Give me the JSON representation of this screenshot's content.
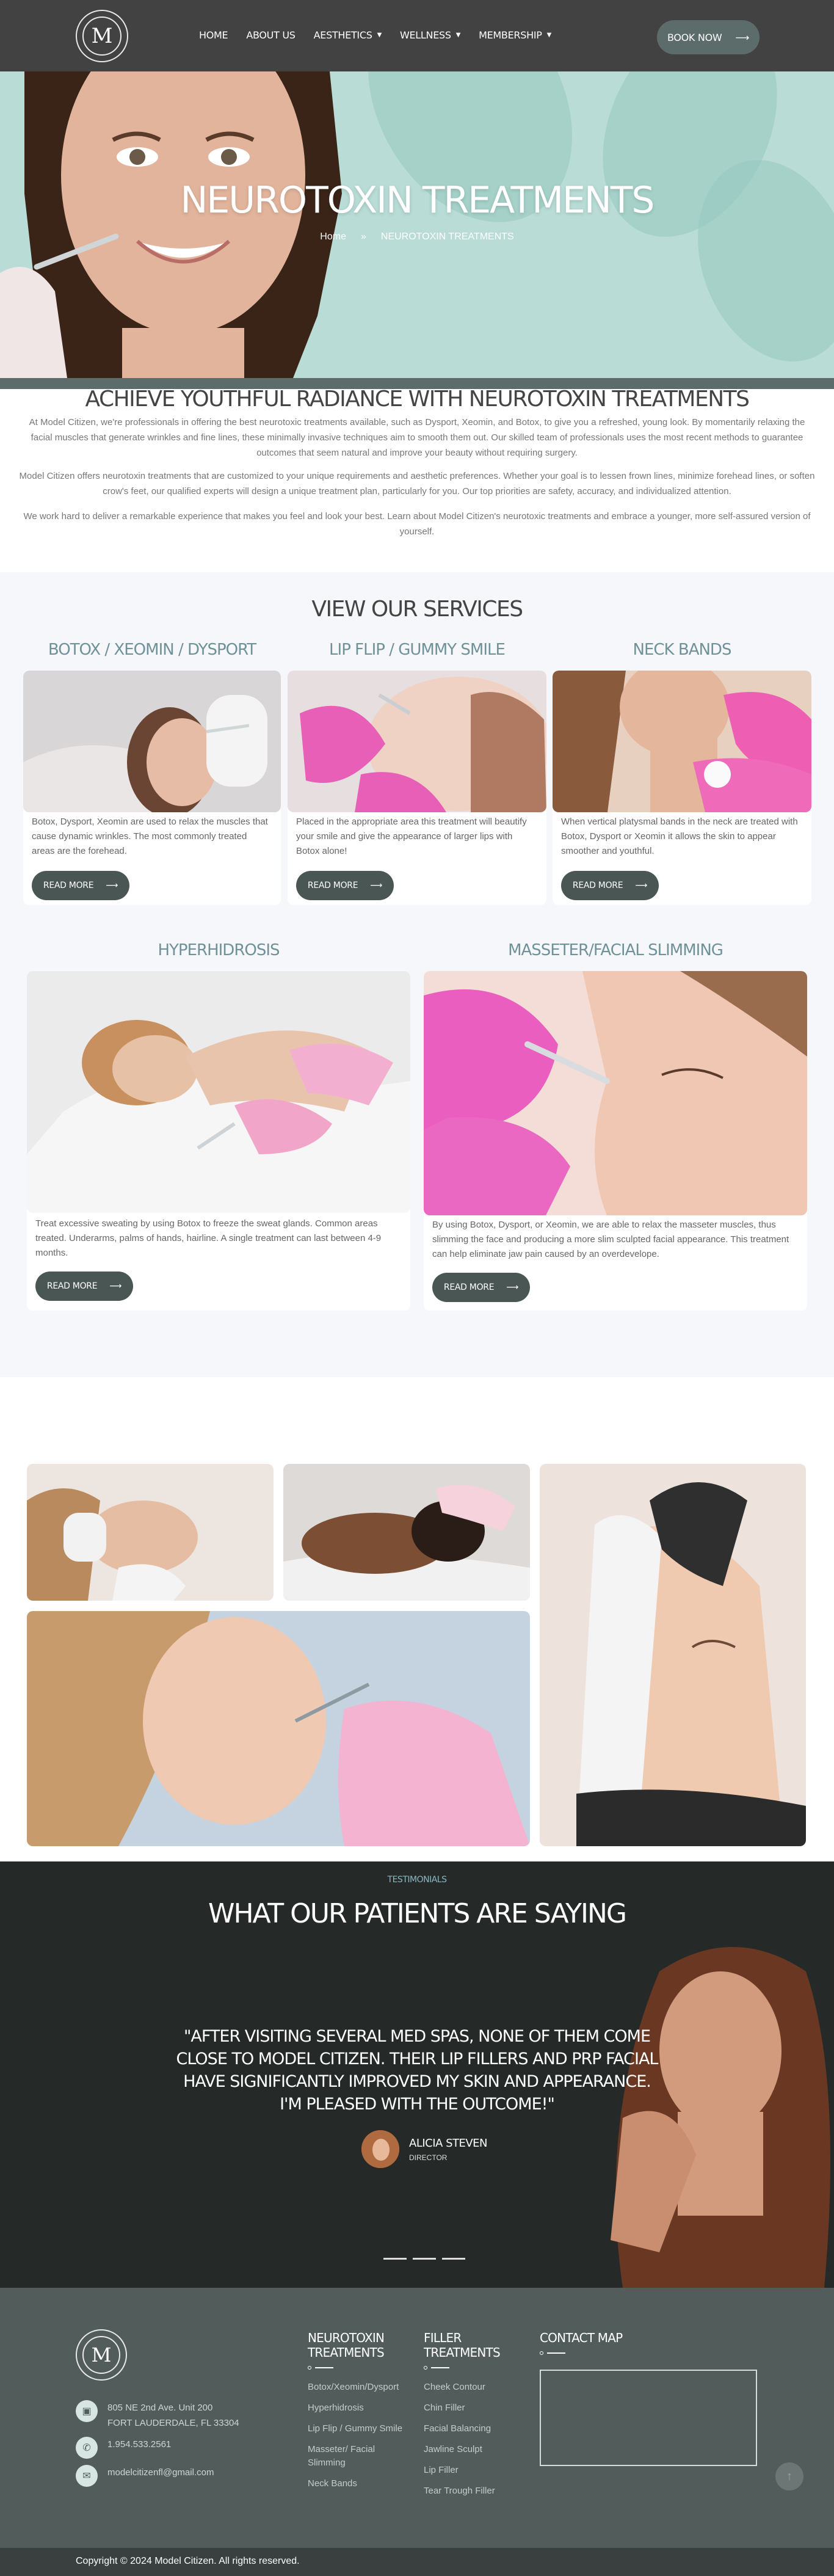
{
  "header": {
    "logo_text": "M",
    "nav": [
      {
        "label": "HOME",
        "dropdown": false
      },
      {
        "label": "ABOUT US",
        "dropdown": false
      },
      {
        "label": "AESTHETICS",
        "dropdown": true
      },
      {
        "label": "WELLNESS",
        "dropdown": true
      },
      {
        "label": "MEMBERSHIP",
        "dropdown": true
      }
    ],
    "book_label": "BOOK NOW"
  },
  "hero": {
    "title": "NEUROTOXIN TREATMENTS",
    "breadcrumb_home": "Home",
    "breadcrumb_sep": "»",
    "breadcrumb_current": "NEUROTOXIN TREATMENTS"
  },
  "intro": {
    "heading": "ACHIEVE YOUTHFUL RADIANCE WITH NEUROTOXIN TREATMENTS",
    "p1": "At Model Citizen, we're professionals in offering the best neurotoxic treatments available, such as Dysport, Xeomin, and Botox, to give you a refreshed, young look. By momentarily relaxing the facial muscles that generate wrinkles and fine lines, these minimally invasive techniques aim to smooth them out. Our skilled team of professionals uses the most recent methods to guarantee outcomes that seem natural and improve your beauty without requiring surgery.",
    "p2": "Model Citizen offers neurotoxin treatments that are customized to your unique requirements and aesthetic preferences. Whether your goal is to lessen frown lines, minimize forehead lines, or soften crow's feet, our qualified experts will design a unique treatment plan, particularly for you. Our top priorities are safety, accuracy, and individualized attention.",
    "p3": "We work hard to deliver a remarkable experience that makes you feel and look your best. Learn about Model Citizen's neurotoxic treatments and embrace a younger, more self-assured version of yourself."
  },
  "services": {
    "heading": "VIEW OUR SERVICES",
    "read_more": "READ MORE",
    "items": [
      {
        "title": "BOTOX / XEOMIN / DYSPORT",
        "text": "Botox, Dysport, Xeomin are used to relax the muscles that cause dynamic wrinkles. The most commonly treated areas are the forehead."
      },
      {
        "title": "LIP FLIP / GUMMY SMILE",
        "text": "Placed in the appropriate area this treatment will beautify your smile and give the appearance of larger lips with Botox alone!"
      },
      {
        "title": "NECK BANDS",
        "text": "When vertical platysmal bands in the neck are treated with Botox, Dysport or Xeomin it allows the skin to appear smoother and youthful."
      },
      {
        "title": "HYPERHIDROSIS",
        "text": "Treat excessive sweating by using Botox to freeze the sweat glands. Common areas treated. Underarms, palms of hands, hairline. A single treatment can last between 4-9 months."
      },
      {
        "title": "MASSETER/FACIAL SLIMMING",
        "text": "By using Botox, Dysport, or Xeomin, we are able to relax the masseter muscles, thus slimming the face and producing a more slim sculpted facial appearance. This treatment can help eliminate jaw pain caused by an overdevelope."
      }
    ]
  },
  "testimonials": {
    "label": "TESTIMONIALS",
    "heading": "WHAT OUR PATIENTS ARE SAYING",
    "quote": "\"AFTER VISITING SEVERAL MED SPAS, NONE OF THEM COME CLOSE TO MODEL CITIZEN. THEIR LIP FILLERS AND PRP FACIAL HAVE SIGNIFICANTLY IMPROVED MY SKIN AND APPEARANCE. I'M PLEASED WITH THE OUTCOME!\"",
    "author_name": "ALICIA STEVEN",
    "author_role": "DIRECTOR"
  },
  "footer": {
    "address_line1": "805 NE 2nd Ave. Unit 200",
    "address_line2": "FORT LAUDERDALE, FL 33304",
    "phone": "1.954.533.2561",
    "email": "modelcitizenfl@gmail.com",
    "col1_title": "NEUROTOXIN TREATMENTS",
    "col1_items": [
      "Botox/Xeomin/Dysport",
      "Hyperhidrosis",
      "Lip Flip / Gummy Smile",
      "Masseter/ Facial Slimming",
      "Neck Bands"
    ],
    "col2_title": "FILLER TREATMENTS",
    "col2_items": [
      "Cheek Contour",
      "Chin Filler",
      "Facial Balancing",
      "Jawline Sculpt",
      "Lip Filler",
      "Tear Trough Filler"
    ],
    "col3_title": "CONTACT MAP",
    "copyright": "Copyright © 2024 Model Citizen. All rights reserved."
  }
}
